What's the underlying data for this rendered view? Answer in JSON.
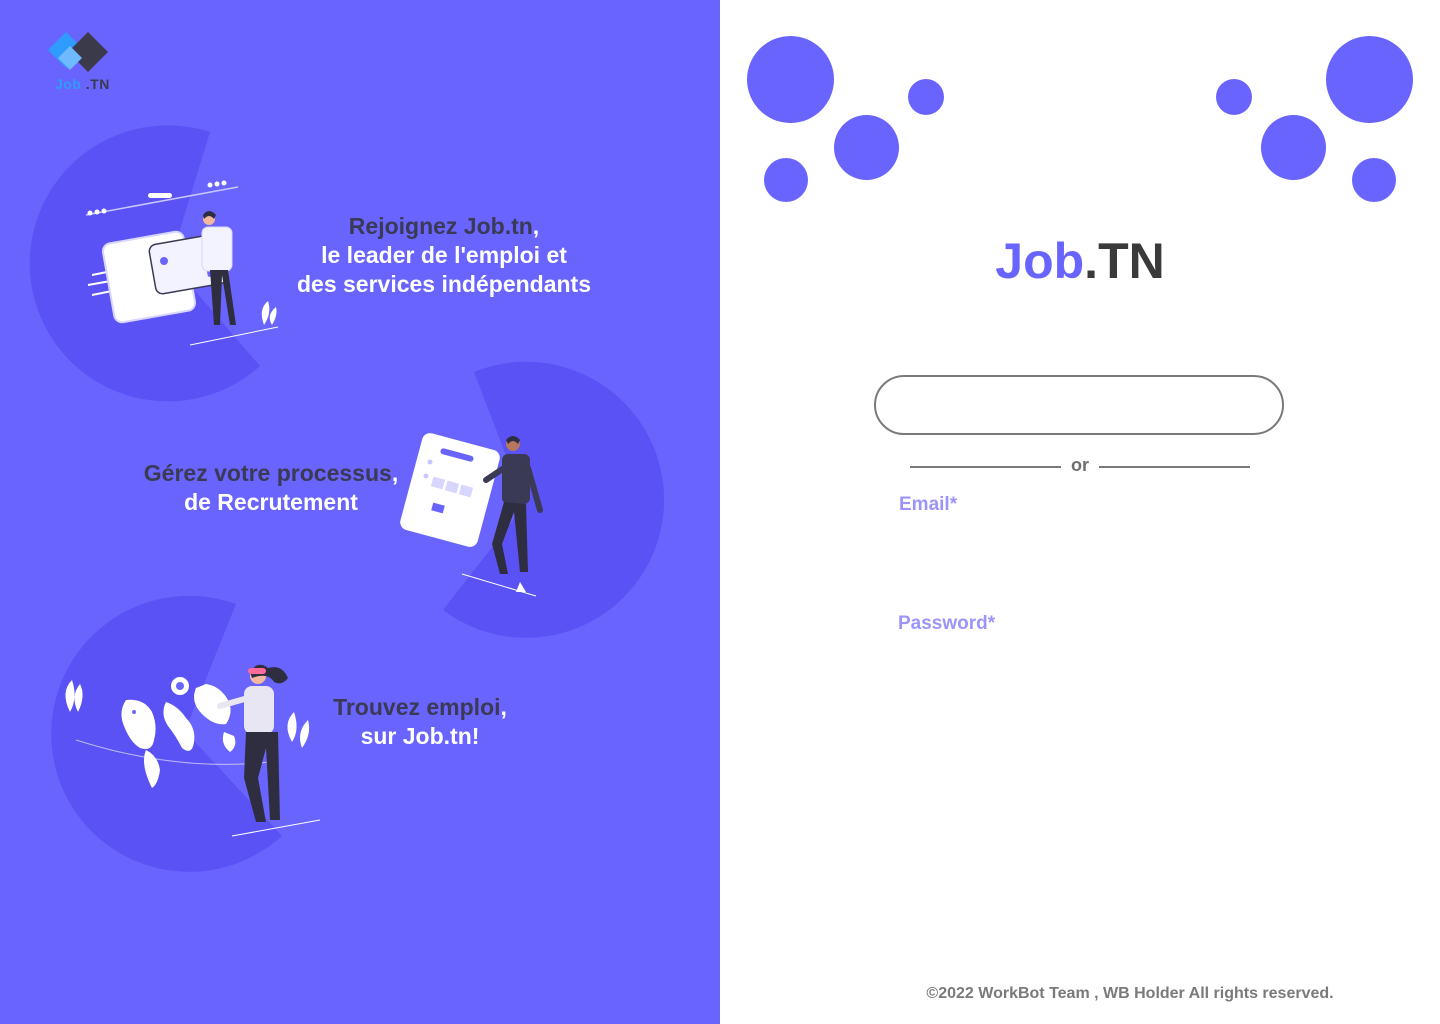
{
  "logo": {
    "text_part1": "Job",
    "text_part2": ".TN"
  },
  "features": [
    {
      "line1_dark": "Rejoignez Job.tn",
      "line1_light": ",",
      "line2": "le leader de l'emploi et",
      "line3": "des services indépendants"
    },
    {
      "line1_dark": "Gérez votre processus",
      "line1_light": ",",
      "line2": "de Recrutement"
    },
    {
      "line1_dark": "Trouvez emploi",
      "line1_light": ",",
      "line2": "sur Job.tn!"
    }
  ],
  "brand": {
    "accent": "Job",
    "rest": ".TN"
  },
  "divider": {
    "or_label": "or"
  },
  "form": {
    "email_label": "Email*",
    "password_label": "Password*"
  },
  "footer": {
    "copyright": "©2022 WorkBot Team , WB Holder All rights reserved."
  },
  "colors": {
    "primary": "#6A64FE",
    "blob": "#5A52F5",
    "label": "#9C95F8",
    "dark_text": "#3A3A55"
  }
}
